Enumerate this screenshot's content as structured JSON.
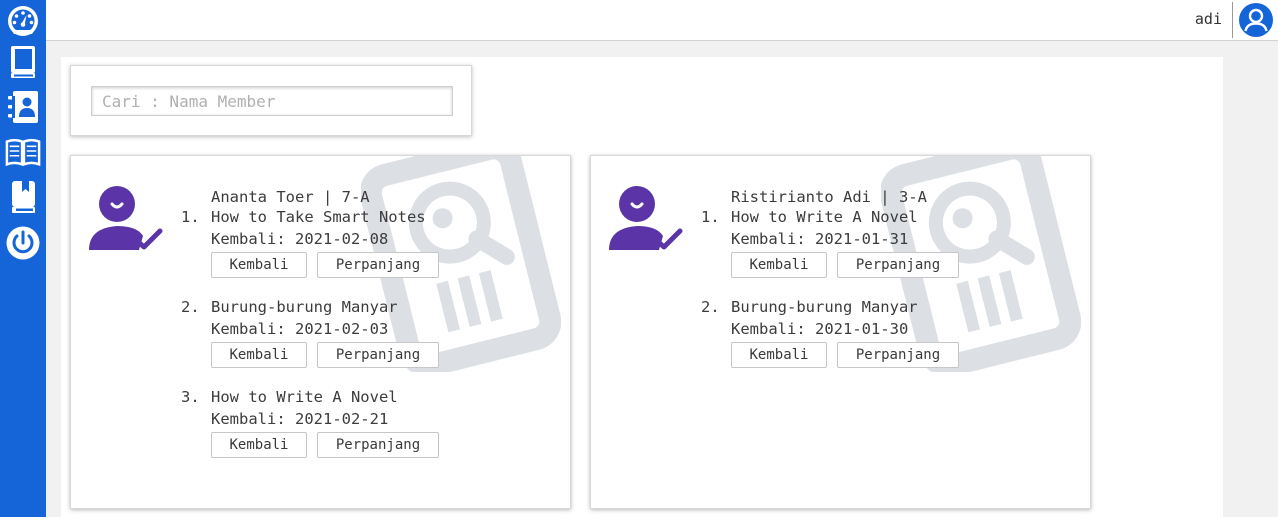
{
  "colors": {
    "sidebar": "#1565d8",
    "member_icon": "#5b35a8",
    "watermark": "#dcdfe4"
  },
  "sidebar": {
    "items": [
      {
        "name": "dashboard",
        "icon": "speedometer-icon"
      },
      {
        "name": "books",
        "icon": "book-icon"
      },
      {
        "name": "members",
        "icon": "contact-book-icon"
      },
      {
        "name": "loans",
        "icon": "open-book-icon"
      },
      {
        "name": "returns",
        "icon": "bookmark-book-icon"
      },
      {
        "name": "logout",
        "icon": "power-icon"
      }
    ]
  },
  "topbar": {
    "username": "adi",
    "avatar_icon": "user-circle-icon"
  },
  "search": {
    "placeholder": "Cari : Nama Member",
    "value": ""
  },
  "buttons": {
    "return_label": "Kembali",
    "extend_label": "Perpanjang"
  },
  "members": [
    {
      "name": "Ananta Toer",
      "class": "7-A",
      "loans": [
        {
          "no": "1.",
          "title": "How to Take Smart Notes",
          "due": "2021-02-08"
        },
        {
          "no": "2.",
          "title": "Burung-burung Manyar",
          "due": "2021-02-03"
        },
        {
          "no": "3.",
          "title": "How to Write A Novel",
          "due": "2021-02-21"
        }
      ]
    },
    {
      "name": "Ristirianto Adi",
      "class": "3-A",
      "loans": [
        {
          "no": "1.",
          "title": "How to Write A Novel",
          "due": "2021-01-31"
        },
        {
          "no": "2.",
          "title": "Burung-burung Manyar",
          "due": "2021-01-30"
        }
      ]
    }
  ],
  "due_prefix": "Kembali: "
}
